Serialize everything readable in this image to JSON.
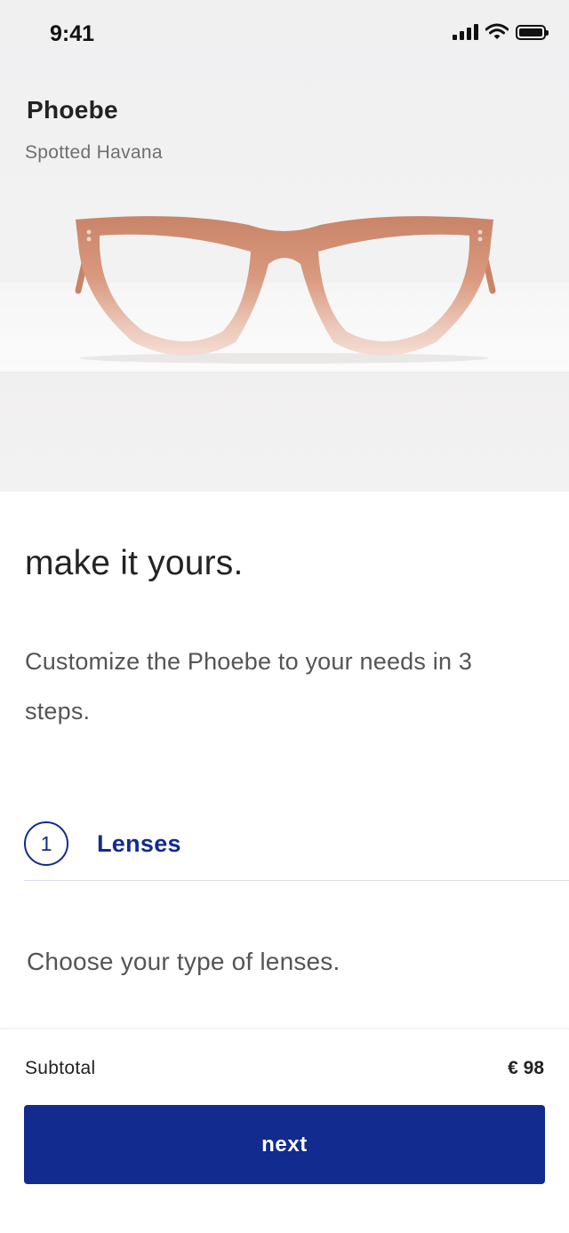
{
  "status_bar": {
    "time": "9:41"
  },
  "product": {
    "name": "Phoebe",
    "color": "Spotted Havana"
  },
  "main": {
    "headline": "make it yours.",
    "intro": "Customize the Phoebe to your needs in 3 steps.",
    "step": {
      "number": "1",
      "label": "Lenses"
    },
    "prompt": "Choose your type of lenses."
  },
  "footer": {
    "subtotal_label": "Subtotal",
    "subtotal_value": "€ 98",
    "next_label": "next"
  },
  "colors": {
    "accent": "#112b8f",
    "frame": "#d99a7f"
  },
  "icons": [
    "signal-icon",
    "wifi-icon",
    "battery-icon",
    "glasses-image"
  ]
}
